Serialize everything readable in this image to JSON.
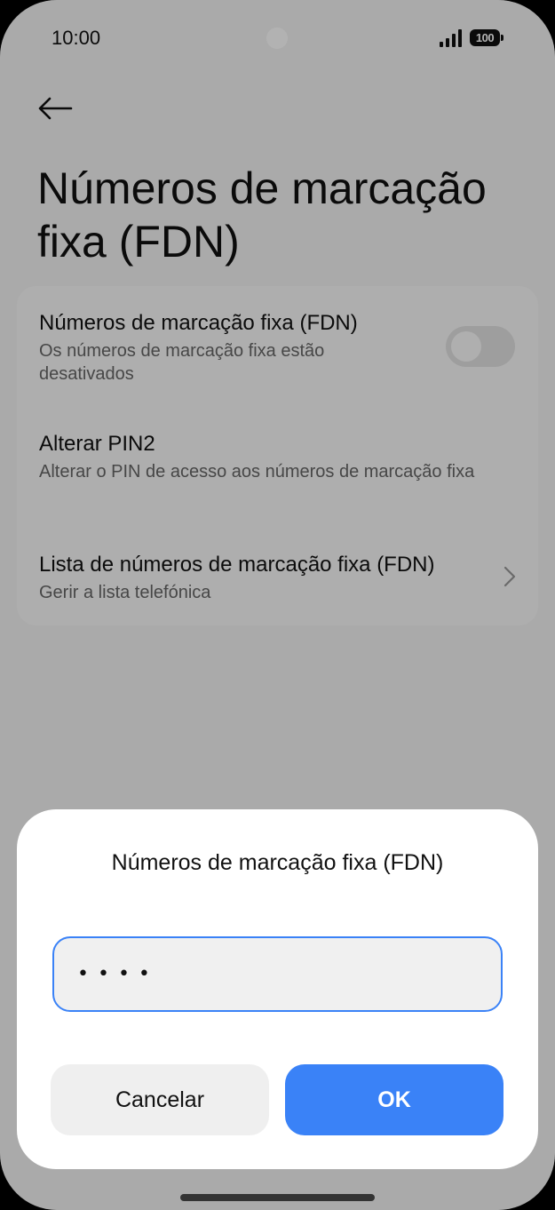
{
  "status_bar": {
    "time": "10:00",
    "battery": "100"
  },
  "header": {
    "back_icon": "arrow-left-icon",
    "title": "Números de marcação fixa (FDN)"
  },
  "settings": {
    "items": [
      {
        "title": "Números de marcação fixa (FDN)",
        "subtitle": "Os números de marcação fixa estão desativados",
        "toggle_on": false
      },
      {
        "title": "Alterar PIN2",
        "subtitle": "Alterar o PIN de acesso aos números de marcação fixa"
      },
      {
        "title": "Lista de números de marcação fixa (FDN)",
        "subtitle": "Gerir a lista telefónica",
        "icon": "chevron-right-icon"
      }
    ]
  },
  "dialog": {
    "title": "Números de marcação fixa (FDN)",
    "pin_value": "••••",
    "cancel_label": "Cancelar",
    "ok_label": "OK"
  },
  "colors": {
    "accent": "#3a82f7",
    "scrim": "rgba(0,0,0,0.30)"
  }
}
